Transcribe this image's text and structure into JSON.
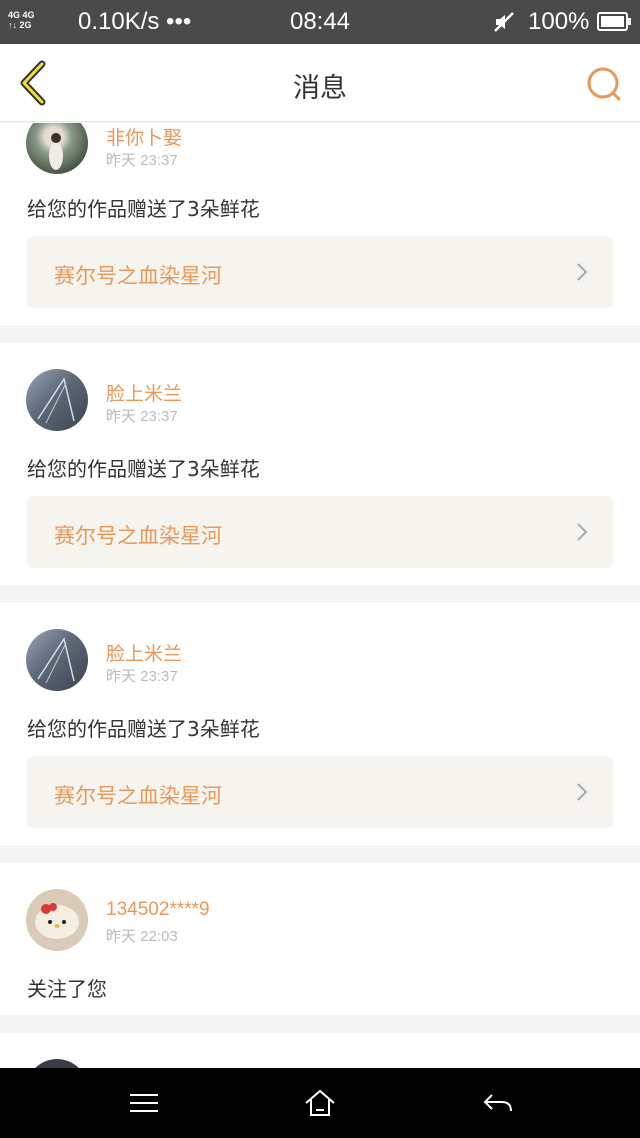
{
  "status_bar": {
    "signal_top": "4G 4G",
    "signal_bottom": "↑↓ 2G",
    "net_speed": "0.10K/s •••",
    "time": "08:44",
    "battery": "100%"
  },
  "header": {
    "title": "消息",
    "accent_color": "#e9985a"
  },
  "messages": [
    {
      "user": "非你卜娶",
      "time": "昨天 23:37",
      "text": "给您的作品赠送了3朵鲜花",
      "work": "赛尔号之血染星河"
    },
    {
      "user": "脸上米兰",
      "time": "昨天 23:37",
      "text": "给您的作品赠送了3朵鲜花",
      "work": "赛尔号之血染星河"
    },
    {
      "user": "脸上米兰",
      "time": "昨天 23:37",
      "text": "给您的作品赠送了3朵鲜花",
      "work": "赛尔号之血染星河"
    },
    {
      "user": "134502****9",
      "time": "昨天 22:03",
      "text": "关注了您"
    }
  ],
  "nav_bar": {
    "icons": [
      "menu-icon",
      "home-icon",
      "back-arrow-icon"
    ]
  }
}
